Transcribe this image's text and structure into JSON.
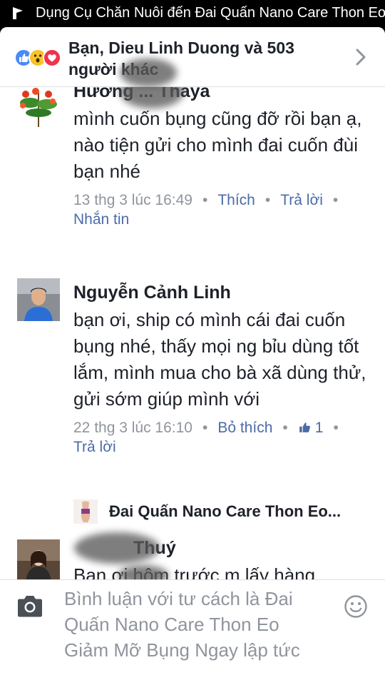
{
  "status_bar": {
    "notification_text": "Dụng Cụ Chăn Nuôi đến Đai Quấn Nano Care Thon Eo",
    "icon": "flag-icon"
  },
  "reactions": {
    "icons": [
      "like-reaction-icon",
      "wow-reaction-icon",
      "love-reaction-icon"
    ],
    "text": "Bạn, Dieu Linh Duong và 503 người khác",
    "colors": {
      "like": "#4a8af4",
      "wow": "#f7c22a",
      "love": "#f0334d"
    }
  },
  "comments": [
    {
      "name": "Hương ... Thaya",
      "text": "mình cuốn bụng cũng đỡ rồi bạn ạ, nào tiện gửi cho mình đai cuốn đùi bạn nhé",
      "time": "13 thg 3 lúc 16:49",
      "like_action": "Thích",
      "reply_action": "Trả lời",
      "message_action": "Nhắn tin"
    },
    {
      "name": "Nguyễn Cảnh Linh",
      "text": "bạn ơi, ship có mình cái đai cuốn bụng nhé, thấy mọi ng bỉu dùng tốt lắm, mình mua cho bà xã dùng thử, gửi sớm giúp mình với",
      "time": "22 thg 3 lúc 16:10",
      "like_action": "Bỏ thích",
      "like_count": "1",
      "reply_action": "Trả lời"
    },
    {
      "name": "Thuý",
      "text": "Bạn ơi hôm trước m lấy hàng"
    }
  ],
  "page_reply": {
    "name": "Đai Quấn Nano Care Thon Eo..."
  },
  "composer": {
    "placeholder": "Bình luận với tư cách là Đai Quấn Nano Care Thon Eo Giảm Mỡ Bụng Ngay lập tức"
  },
  "theme": {
    "link_color": "#4b6ba8",
    "meta_color": "#90949c",
    "text_color": "#1d2129"
  }
}
